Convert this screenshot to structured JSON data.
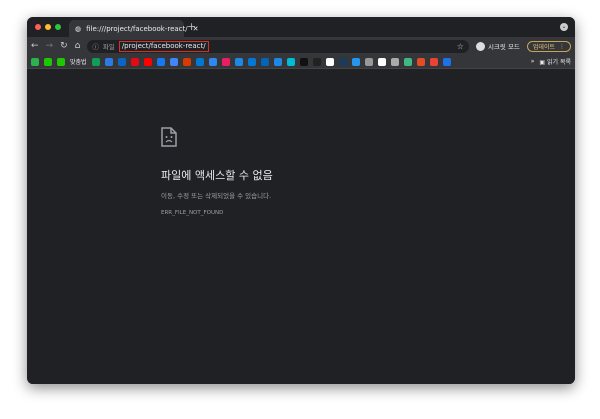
{
  "tab": {
    "title": "file:///project/facebook-react/"
  },
  "toolbar": {
    "site_label": "파일",
    "url": "/project/facebook-react/",
    "incognito": "시크릿 모드",
    "update": "업데이트"
  },
  "bookmarks": {
    "colors": [
      "#2bb24c",
      "#1ec800",
      "#1ec800",
      "#0f9d58",
      "#2c7be5",
      "#0a66c2",
      "#e50914",
      "#ff0000",
      "#1877f2",
      "#4285f4",
      "#d83b01",
      "#0078d4",
      "#2d89ef",
      "#e91e63",
      "#1e88e5",
      "#0078d4",
      "#0364b8",
      "#1e88e5",
      "#00bcd4",
      "#111111",
      "#222222",
      "#ffffff",
      "#1b3a5c",
      "#2496ed",
      "#999999",
      "#ffffff",
      "#aaaaaa",
      "#41b883",
      "#e34c26",
      "#ea4335",
      "#1a73e8"
    ],
    "spell_label": "맞춤법",
    "reading_list": "읽기 목록"
  },
  "error": {
    "title": "파일에 액세스할 수 없음",
    "message": "이동, 수정 또는 삭제되었을 수 있습니다.",
    "code": "ERR_FILE_NOT_FOUND"
  }
}
